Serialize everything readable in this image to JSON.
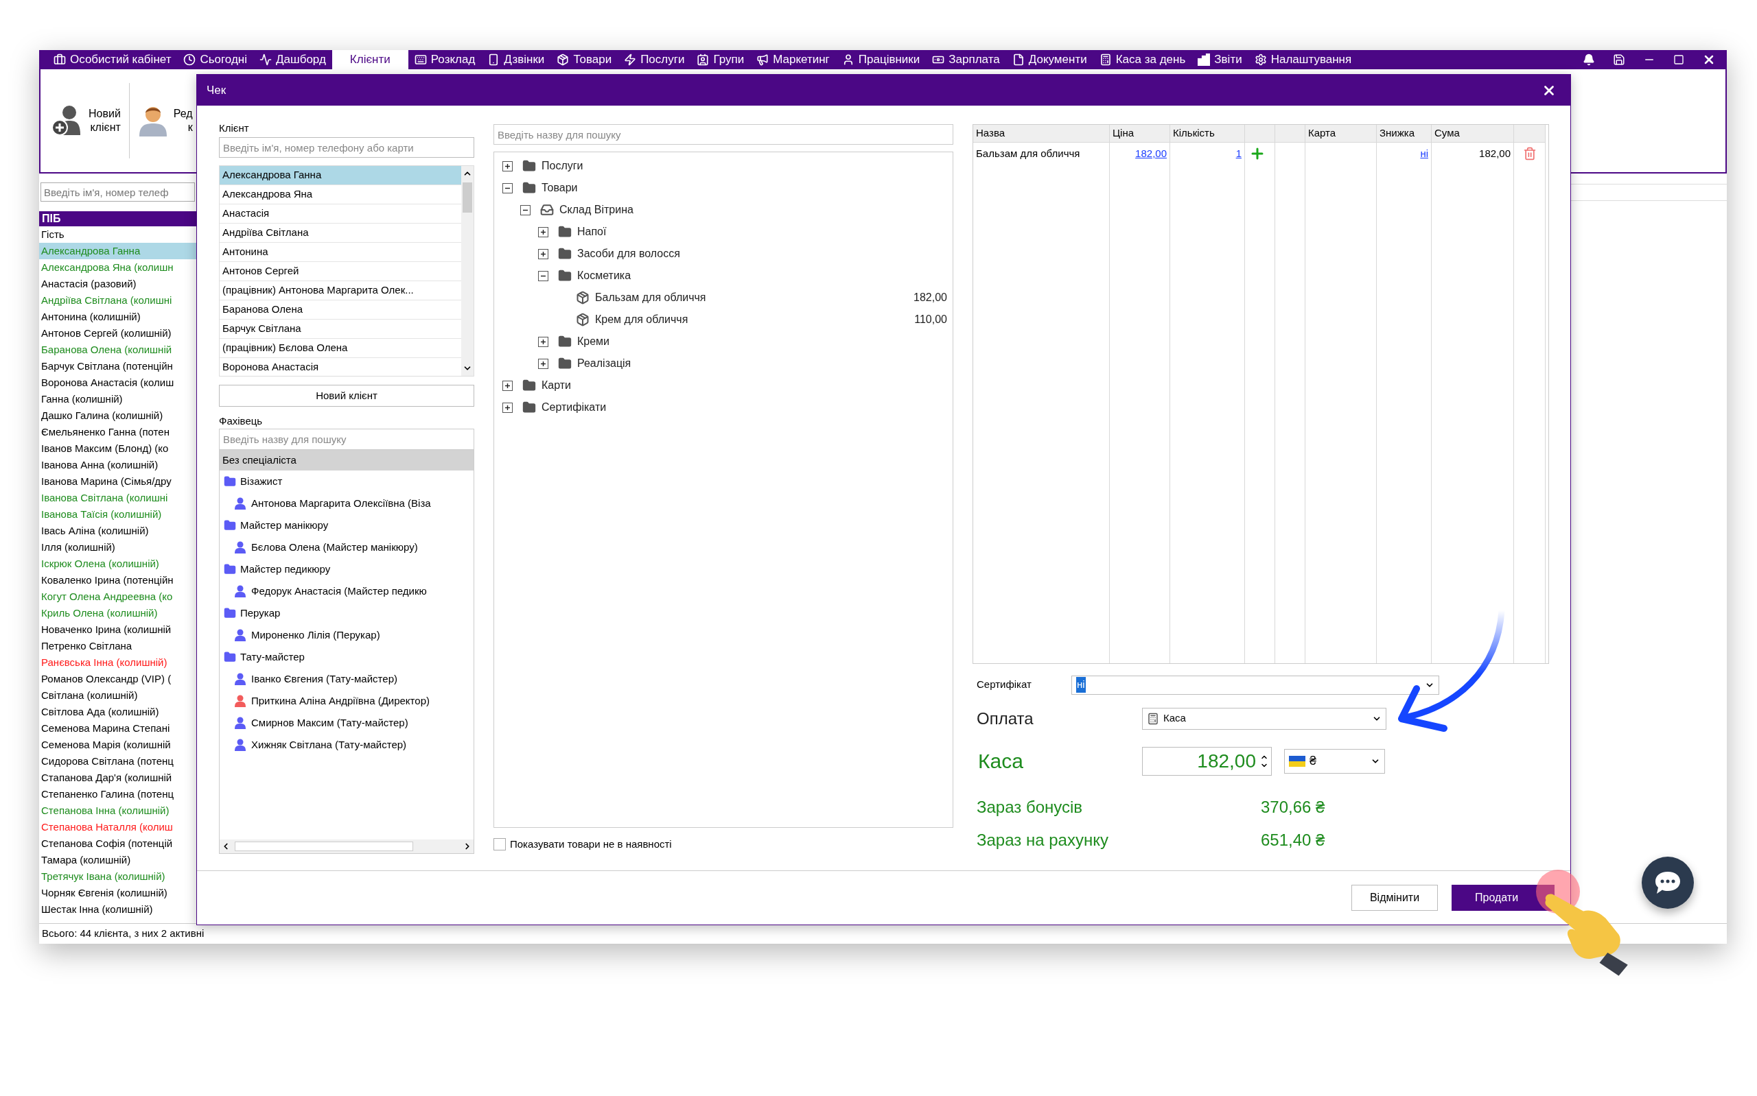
{
  "menu": {
    "items": [
      {
        "label": "Особистий кабінет",
        "selected": false
      },
      {
        "label": "Сьогодні",
        "selected": false
      },
      {
        "label": "Дашборд",
        "selected": false
      },
      {
        "label": "Клієнти",
        "selected": true
      },
      {
        "label": "Розклад",
        "selected": false
      },
      {
        "label": "Дзвінки",
        "selected": false
      },
      {
        "label": "Товари",
        "selected": false
      },
      {
        "label": "Послуги",
        "selected": false
      },
      {
        "label": "Групи",
        "selected": false
      },
      {
        "label": "Маркетинг",
        "selected": false
      },
      {
        "label": "Працівники",
        "selected": false
      },
      {
        "label": "Зарплата",
        "selected": false
      },
      {
        "label": "Документи",
        "selected": false
      },
      {
        "label": "Каса за день",
        "selected": false
      },
      {
        "label": "Звіти",
        "selected": false
      },
      {
        "label": "Налаштування",
        "selected": false
      }
    ]
  },
  "toolbar": {
    "buttons": [
      {
        "kind": "new",
        "lines": [
          "Новий",
          "клієнт"
        ]
      },
      {
        "kind": "edit",
        "lines": [
          "Ред",
          "к"
        ]
      }
    ]
  },
  "client_list": {
    "search": {
      "placeholder": "Введіть ім'я, номер телеф"
    },
    "column": "ПІБ",
    "rows": [
      {
        "name": "Гість",
        "color": "#000000",
        "selected": false
      },
      {
        "name": "Александрова Ганна",
        "color": "#1e8c1e",
        "selected": true
      },
      {
        "name": "Александрова Яна (колишн",
        "color": "#1e8c1e",
        "selected": false
      },
      {
        "name": "Анастасія (разовий)",
        "color": "#000000",
        "selected": false
      },
      {
        "name": "Андріїва Світлана (колишні",
        "color": "#1e8c1e",
        "selected": false
      },
      {
        "name": "Антонина (колишній)",
        "color": "#000000",
        "selected": false
      },
      {
        "name": "Антонов Сергей (колишній)",
        "color": "#000000",
        "selected": false
      },
      {
        "name": "Баранова Олена (колишній",
        "color": "#1e8c1e",
        "selected": false
      },
      {
        "name": "Барчук Світлана (потенційн",
        "color": "#000000",
        "selected": false
      },
      {
        "name": "Воронова Анастасія (колиш",
        "color": "#000000",
        "selected": false
      },
      {
        "name": "Ганна (колишній)",
        "color": "#000000",
        "selected": false
      },
      {
        "name": "Дашко Галина (колишній)",
        "color": "#000000",
        "selected": false
      },
      {
        "name": "Ємельяненко Ганна (потен",
        "color": "#000000",
        "selected": false
      },
      {
        "name": "Іванов Максим (Блонд) (ко",
        "color": "#000000",
        "selected": false
      },
      {
        "name": "Іванова Анна (колишній)",
        "color": "#000000",
        "selected": false
      },
      {
        "name": "Іванова Марина (Сімья/дру",
        "color": "#000000",
        "selected": false
      },
      {
        "name": "Іванова Світлана (колишні",
        "color": "#1e8c1e",
        "selected": false
      },
      {
        "name": "Іванова Таїсія (колишній)",
        "color": "#1e8c1e",
        "selected": false
      },
      {
        "name": "Івась Аліна (колишній)",
        "color": "#000000",
        "selected": false
      },
      {
        "name": "Ілля (колишній)",
        "color": "#000000",
        "selected": false
      },
      {
        "name": "Іскрюк Олена (колишній)",
        "color": "#1e8c1e",
        "selected": false
      },
      {
        "name": "Коваленко Ірина (потенційн",
        "color": "#000000",
        "selected": false
      },
      {
        "name": "Когут Олена Андреевна (ко",
        "color": "#1e8c1e",
        "selected": false
      },
      {
        "name": "Криль Олена (колишній)",
        "color": "#1e8c1e",
        "selected": false
      },
      {
        "name": "Новаченко Ірина (колишній",
        "color": "#000000",
        "selected": false
      },
      {
        "name": "Петренко Світлана",
        "color": "#000000",
        "selected": false
      },
      {
        "name": "Ранєвська Інна (колишній)",
        "color": "#ff1a1a",
        "selected": false
      },
      {
        "name": "Романов Олександр (VIP) (",
        "color": "#000000",
        "selected": false
      },
      {
        "name": "Світлана (колишній)",
        "color": "#000000",
        "selected": false
      },
      {
        "name": "Світлова Ада (колишній)",
        "color": "#000000",
        "selected": false
      },
      {
        "name": "Семенова Марина Степані",
        "color": "#000000",
        "selected": false
      },
      {
        "name": "Семенова Марія (колишній",
        "color": "#000000",
        "selected": false
      },
      {
        "name": "Сидорова Світлана (потенц",
        "color": "#000000",
        "selected": false
      },
      {
        "name": "Стапанова Дар'я (колишній",
        "color": "#000000",
        "selected": false
      },
      {
        "name": "Степаненко Галина (потенц",
        "color": "#000000",
        "selected": false
      },
      {
        "name": "Степанова Інна (колишній)",
        "color": "#1e8c1e",
        "selected": false
      },
      {
        "name": "Степанова Наталля (колиш",
        "color": "#ff1a1a",
        "selected": false
      },
      {
        "name": "Степанова Софія (потенцій",
        "color": "#000000",
        "selected": false
      },
      {
        "name": "Тамара (колишній)",
        "color": "#000000",
        "selected": false
      },
      {
        "name": "Третячук Івана (колишній)",
        "color": "#1e8c1e",
        "selected": false
      },
      {
        "name": "Чорняк Євгенія (колишній)",
        "color": "#000000",
        "selected": false
      },
      {
        "name": "Шестак Інна (колишній)",
        "color": "#000000",
        "selected": false
      }
    ],
    "footer": "Всього: 44 клієнта, з них 2 активні"
  },
  "dialog": {
    "title": "Чек",
    "client": {
      "label": "Клієнт",
      "search": {
        "placeholder": "Введіть ім'я, номер телефону або карти"
      },
      "items": [
        {
          "name": "Александрова Ганна",
          "selected": true
        },
        {
          "name": "Александрова Яна",
          "selected": false
        },
        {
          "name": "Анастасія",
          "selected": false
        },
        {
          "name": "Андріїва Світлана",
          "selected": false
        },
        {
          "name": "Антонина",
          "selected": false
        },
        {
          "name": "Антонов Сергей",
          "selected": false
        },
        {
          "name": "(працівник) Антонова Маргарита Олек...",
          "selected": false
        },
        {
          "name": "Баранова Олена",
          "selected": false
        },
        {
          "name": "Барчук Світлана",
          "selected": false
        },
        {
          "name": "(працівник) Бєлова Олена",
          "selected": false
        },
        {
          "name": "Воронова Анастасія",
          "selected": false
        }
      ],
      "new_button": "Новий клієнт"
    },
    "specialist": {
      "label": "Фахівець",
      "search": {
        "placeholder": "Введіть назву для пошуку"
      },
      "tree": [
        {
          "kind": "none",
          "name": "Без спеціаліста",
          "selected": true
        },
        {
          "kind": "group",
          "name": "Візажист",
          "selected": false,
          "children": [
            {
              "name": "Антонова Маргарита Олексіївна (Віза",
              "color": "#5b5bf5",
              "selected": false
            }
          ]
        },
        {
          "kind": "group",
          "name": "Майстер манікюру",
          "selected": false,
          "children": [
            {
              "name": "Бєлова Олена (Майстер манікюру)",
              "color": "#5b5bf5",
              "selected": false
            }
          ]
        },
        {
          "kind": "group",
          "name": "Майстер педикюру",
          "selected": false,
          "children": [
            {
              "name": "Федорук Анастасія (Майстер педикю",
              "color": "#5b5bf5",
              "selected": false
            }
          ]
        },
        {
          "kind": "group",
          "name": "Перукар",
          "selected": false,
          "children": [
            {
              "name": "Мироненко Лілія (Перукар)",
              "color": "#5b5bf5",
              "selected": false
            }
          ]
        },
        {
          "kind": "group",
          "name": "Тату-майстер",
          "selected": false,
          "children": [
            {
              "name": "Іванко Євгения (Тату-майстер)",
              "color": "#5b5bf5",
              "selected": false
            },
            {
              "name": "Приткина Аліна Андріївна (Директор)",
              "color": "#f25c5c",
              "selected": false
            },
            {
              "name": "Смирнов Максим (Тату-майстер)",
              "color": "#5b5bf5",
              "selected": false
            },
            {
              "name": "Хижняк Світлана (Тату-майстер)",
              "color": "#5b5bf5",
              "selected": false
            }
          ]
        }
      ]
    },
    "catalog": {
      "search": {
        "placeholder": "Введіть назву для пошуку"
      },
      "tree": [
        {
          "kind": "folder",
          "name": "Послуги",
          "expanded": false
        },
        {
          "kind": "folder",
          "name": "Товари",
          "expanded": true,
          "children": [
            {
              "kind": "store",
              "name": "Склад Вітрина",
              "expanded": true,
              "children": [
                {
                  "kind": "folder",
                  "name": "Напої",
                  "expanded": false
                },
                {
                  "kind": "folder",
                  "name": "Засоби для волосся",
                  "expanded": false
                },
                {
                  "kind": "folder",
                  "name": "Косметика",
                  "expanded": true,
                  "children": [
                    {
                      "kind": "product",
                      "name": "Бальзам для обличчя",
                      "price": "182,00"
                    },
                    {
                      "kind": "product",
                      "name": "Крем для обличчя",
                      "price": "110,00"
                    }
                  ]
                },
                {
                  "kind": "folder",
                  "name": "Креми",
                  "expanded": false
                },
                {
                  "kind": "folder",
                  "name": "Реалізація",
                  "expanded": false
                }
              ]
            }
          ]
        },
        {
          "kind": "folder",
          "name": "Карти",
          "expanded": false
        },
        {
          "kind": "folder",
          "name": "Сертифікати",
          "expanded": false
        }
      ],
      "show_out_of_stock": {
        "label": "Показувати товари не в наявності",
        "checked": false
      }
    },
    "receipt": {
      "columns": [
        {
          "kind": "label",
          "label": "Назва"
        },
        {
          "kind": "label",
          "label": "Ціна"
        },
        {
          "kind": "label",
          "label": "Кількість"
        },
        {
          "kind": "blank"
        },
        {
          "kind": "blank"
        },
        {
          "kind": "label",
          "label": "Карта"
        },
        {
          "kind": "label",
          "label": "Знижка"
        },
        {
          "kind": "label",
          "label": "Сума"
        },
        {
          "kind": "blank"
        }
      ],
      "rows": [
        {
          "cells": [
            {
              "kind": "text",
              "text": "Бальзам для обличчя"
            },
            {
              "kind": "link",
              "text": "182,00"
            },
            {
              "kind": "link",
              "text": "1"
            },
            {
              "kind": "add"
            },
            {
              "kind": "blank"
            },
            {
              "kind": "blank"
            },
            {
              "kind": "link",
              "text": "ні"
            },
            {
              "kind": "number",
              "text": "182,00"
            },
            {
              "kind": "delete"
            }
          ]
        }
      ]
    },
    "certificate": {
      "label": "Сертифікат",
      "value": "ні",
      "text_selected": true
    },
    "payment": {
      "label": "Оплата",
      "value": "Каса"
    },
    "cash": {
      "label": "Каса",
      "amount": "182,00",
      "currency": "₴"
    },
    "bonuses": {
      "label": "Зараз бонусів",
      "value": "370,66 ₴"
    },
    "account": {
      "label": "Зараз на рахунку",
      "value": "651,40 ₴"
    },
    "buttons": [
      {
        "kind": "secondary",
        "label": "Відмінити"
      },
      {
        "kind": "primary",
        "label": "Продати"
      }
    ]
  }
}
